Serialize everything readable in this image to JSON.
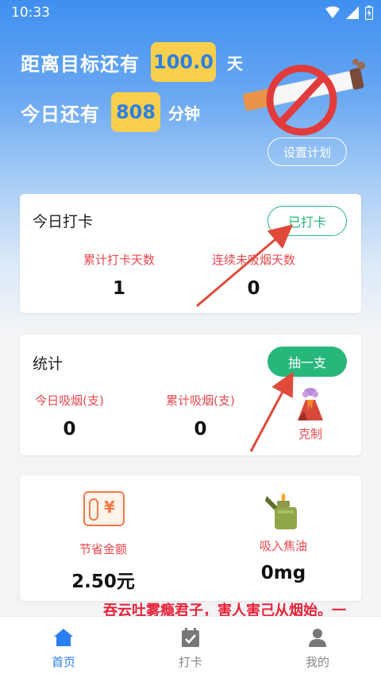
{
  "status_bar": {
    "time": "10:33"
  },
  "hero": {
    "target_label": "距离目标还有",
    "target_value": "100.0",
    "target_unit": "天",
    "today_label": "今日还有",
    "today_value": "808",
    "today_unit": "分钟",
    "plan_button": "设置计划"
  },
  "checkin_card": {
    "title": "今日打卡",
    "button": "已打卡",
    "stats": [
      {
        "label": "累计打卡天数",
        "value": "1"
      },
      {
        "label": "连续未吸烟天数",
        "value": "0"
      }
    ]
  },
  "stats_card": {
    "title": "统计",
    "button": "抽一支",
    "stats": [
      {
        "label": "今日吸烟(支)",
        "value": "0"
      },
      {
        "label": "累计吸烟(支)",
        "value": "0"
      }
    ],
    "restrain_label": "克制"
  },
  "savings_card": {
    "money_label": "节省金额",
    "money_value": "2.50元",
    "money_icon_text": "¥",
    "tar_label": "吸入焦油",
    "tar_value": "0mg"
  },
  "marquee": {
    "text": "吞云吐雾瘾君子，害人害己从烟始。一"
  },
  "bottom_nav": [
    {
      "label": "首页",
      "icon": "home-icon",
      "active": true
    },
    {
      "label": "打卡",
      "icon": "calendar-check-icon",
      "active": false
    },
    {
      "label": "我的",
      "icon": "person-icon",
      "active": false
    }
  ],
  "colors": {
    "primary_blue": "#3f8ff0",
    "pill_yellow": "#f8cf4c",
    "accent_green": "#27b77a",
    "label_red": "#e8484f",
    "arrow_red": "#e04a3a"
  }
}
